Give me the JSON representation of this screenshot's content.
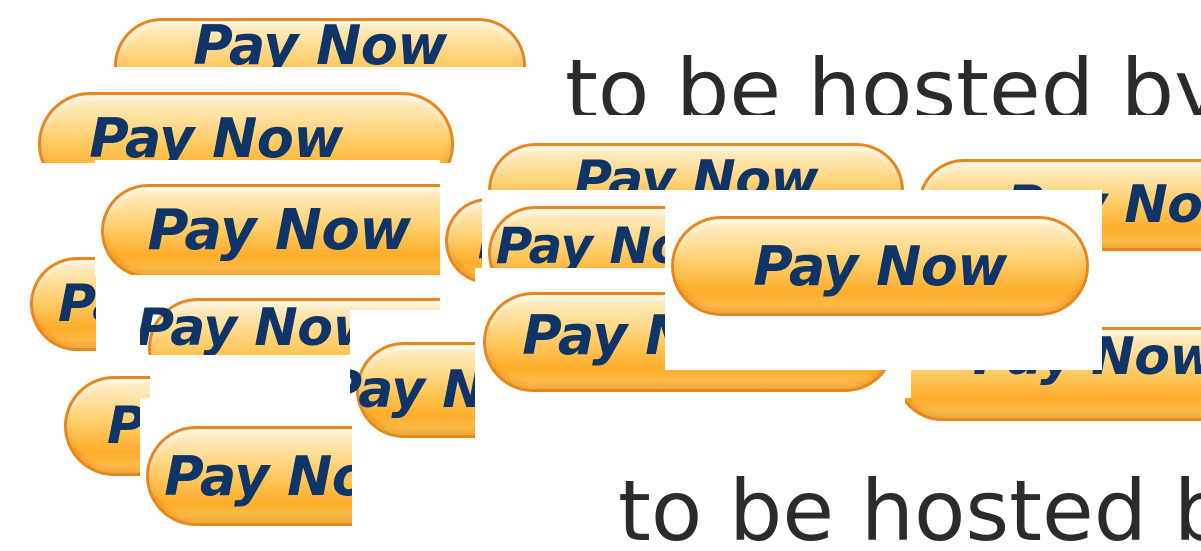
{
  "button_label": "Pay Now",
  "caption_text": "to be hosted by",
  "colors": {
    "button_border": "#e8871c",
    "button_fill_top": "#fff1cf",
    "button_fill_mid": "#ffc85c",
    "button_fill_bottom": "#ffad2c",
    "label_text": "#0e3468",
    "caption_text": "#2b2b2b",
    "background": "#ffffff"
  }
}
